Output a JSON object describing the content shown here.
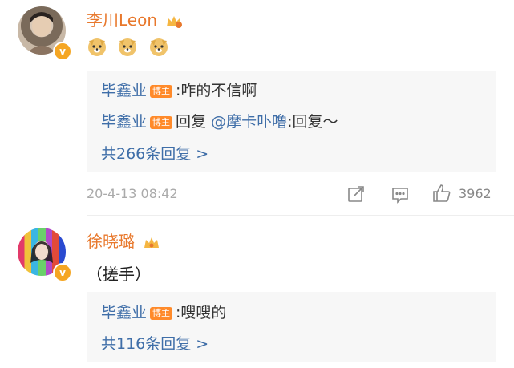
{
  "comments": [
    {
      "username": "李川Leon",
      "text_emoji": [
        "doge",
        "doge",
        "doge"
      ],
      "replies": [
        {
          "name": "毕鑫业",
          "badge": "博主",
          "sep": ":",
          "text": "咋的不信啊"
        },
        {
          "name": "毕鑫业",
          "badge": "博主",
          "reply_prefix": "回复",
          "mention": "@摩卡卟噜",
          "text": ":回复～"
        }
      ],
      "more_replies": "共266条回复 >",
      "timestamp": "20-4-13 08:42",
      "likes": "3962"
    },
    {
      "username": "徐晓璐",
      "text": "（搓手）",
      "replies": [
        {
          "name": "毕鑫业",
          "badge": "博主",
          "sep": ":",
          "text": "嗖嗖的"
        }
      ],
      "more_replies": "共116条回复 >"
    }
  ],
  "colors": {
    "username": "#e8782c",
    "link": "#3f6ea8",
    "badge": "#ff8a2a",
    "verify": "#f5a623"
  }
}
